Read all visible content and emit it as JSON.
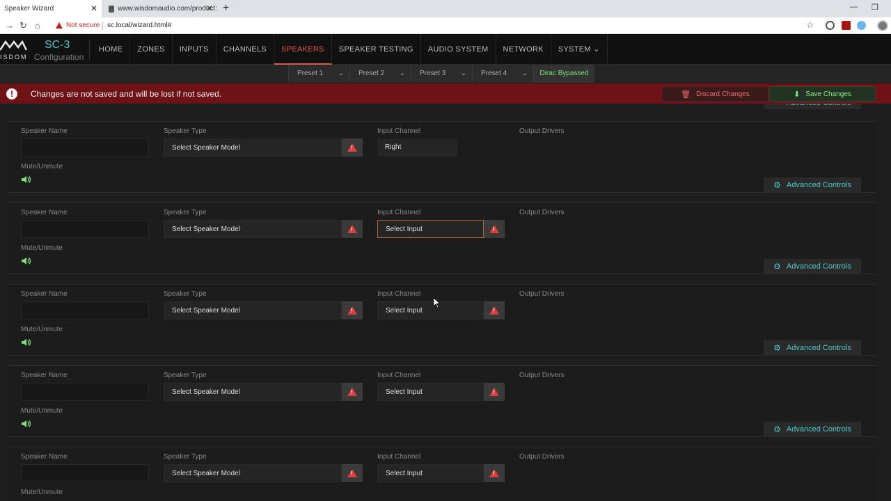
{
  "browser": {
    "tabs": [
      {
        "title": "Speaker Wizard",
        "active": true
      },
      {
        "title": "www.wisdomaudio.com/product:",
        "active": false
      }
    ],
    "security_label": "Not secure",
    "url": "sc.local/wizard.html#"
  },
  "app": {
    "logo_text": "ISDOM",
    "product": "SC-3",
    "subtitle": "Configuration",
    "accent": "#4ec9c6",
    "active_color": "#e2574c",
    "nav": [
      {
        "label": "HOME"
      },
      {
        "label": "ZONES"
      },
      {
        "label": "INPUTS"
      },
      {
        "label": "CHANNELS"
      },
      {
        "label": "SPEAKERS",
        "active": true
      },
      {
        "label": "SPEAKER TESTING"
      },
      {
        "label": "AUDIO SYSTEM"
      },
      {
        "label": "NETWORK"
      },
      {
        "label": "SYSTEM"
      }
    ],
    "presets": [
      "Preset 1",
      "Preset 2",
      "Preset 3",
      "Preset 4"
    ],
    "dirac": "Dirac Bypassed"
  },
  "warning": {
    "message": "Changes are not saved and will be lost if not saved.",
    "discard_label": "Discard Changes",
    "save_label": "Save Changes"
  },
  "labels": {
    "speaker_name": "Speaker Name",
    "speaker_type": "Speaker Type",
    "input_channel": "Input Channel",
    "output_drivers": "Output Drivers",
    "mute": "Mute/Unmute",
    "advanced": "Advanced Controls"
  },
  "speakers": [
    {
      "type": "Select Speaker Model",
      "input": "Right"
    },
    {
      "type": "Select Speaker Model",
      "input": "Select Input"
    },
    {
      "type": "Select Speaker Model",
      "input": "Select Input"
    },
    {
      "type": "Select Speaker Model",
      "input": "Select Input"
    },
    {
      "type": "Select Speaker Model",
      "input": "Select Input"
    }
  ]
}
